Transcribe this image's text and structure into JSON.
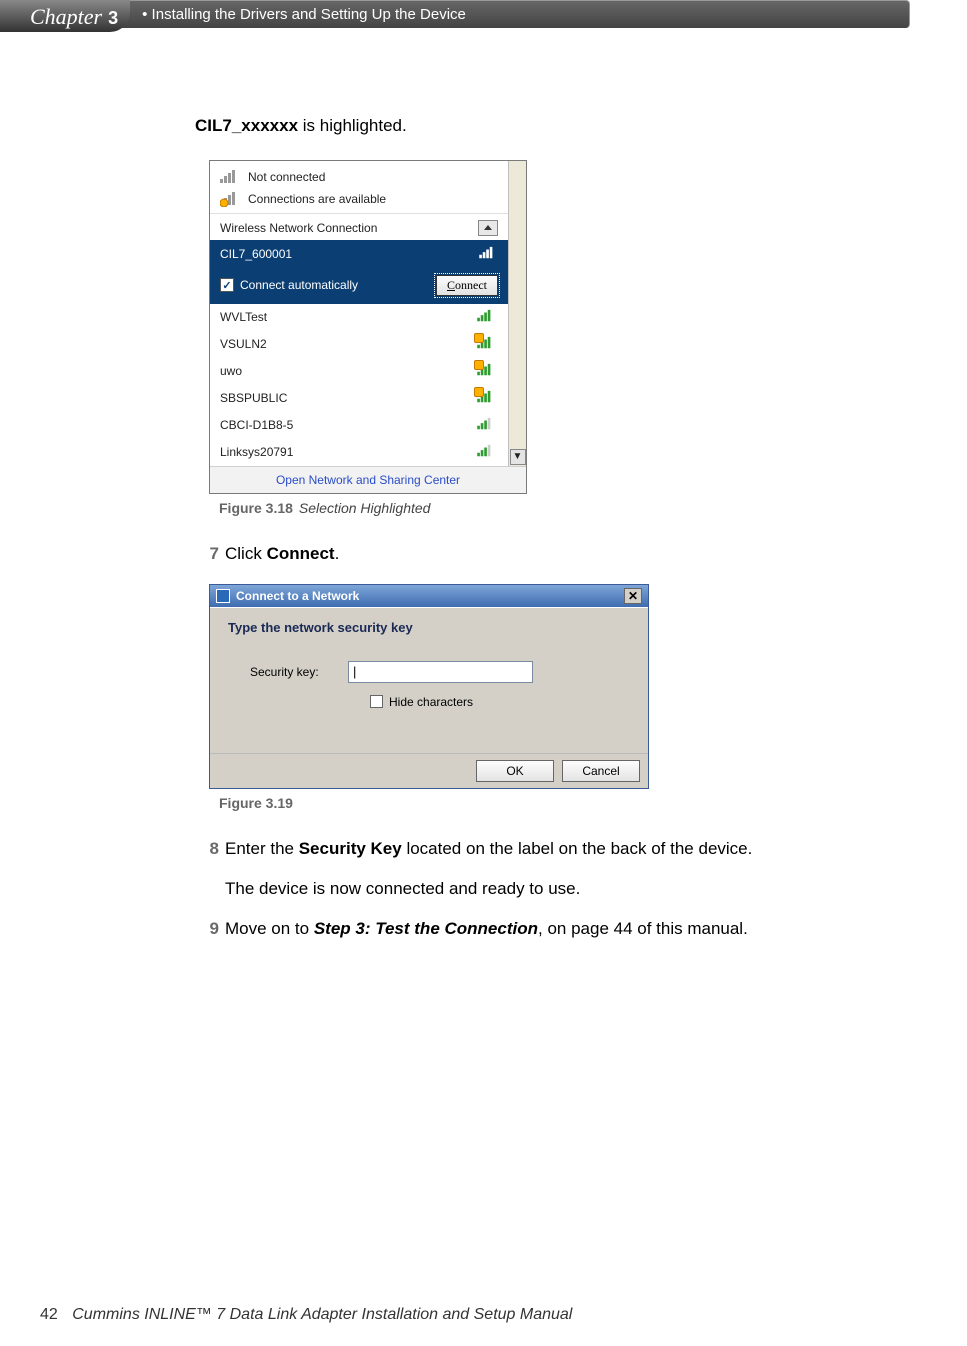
{
  "header": {
    "chapter_word": "Chapter",
    "chapter_number": "3",
    "chapter_title": "• Installing the Drivers and Setting Up the Device"
  },
  "intro_line_prefix_bold": "CIL7_xxxxxx",
  "intro_line_suffix": " is highlighted.",
  "wifi_popup": {
    "not_connected": "Not connected",
    "connections_available": "Connections are available",
    "section_title": "Wireless Network Connection",
    "selected_network": "CIL7_600001",
    "connect_auto_label": "Connect automatically",
    "connect_button_html": "Connect",
    "connect_button_underline": "C",
    "connect_button_rest": "onnect",
    "networks": [
      {
        "name": "WVLTest",
        "secured": false
      },
      {
        "name": "VSULN2",
        "secured": true
      },
      {
        "name": "uwo",
        "secured": true
      },
      {
        "name": "SBSPUBLIC",
        "secured": true
      },
      {
        "name": "CBCI-D1B8-5",
        "secured": false
      },
      {
        "name": "Linksys20791",
        "secured": false
      }
    ],
    "open_center": "Open Network and Sharing Center"
  },
  "figure_318": {
    "label": "Figure 3.18",
    "title": "Selection Highlighted"
  },
  "step7": {
    "num": "7",
    "text_prefix": "Click ",
    "bold": "Connect",
    "suffix": "."
  },
  "dialog": {
    "title": "Connect to a Network",
    "prompt": "Type the network security key",
    "field_label": "Security key:",
    "input_value": "|",
    "hide_label": "Hide characters",
    "ok": "OK",
    "cancel": "Cancel"
  },
  "figure_319": {
    "label": "Figure 3.19",
    "title": ""
  },
  "step8": {
    "num": "8",
    "prefix": "Enter the ",
    "bold": "Security Key",
    "suffix": " located on the label on the back of the device.",
    "extra": "The device is now connected and ready to use."
  },
  "step9": {
    "num": "9",
    "prefix": "Move on to ",
    "bolditalic": "Step 3: Test the Connection",
    "suffix": ", on page 44 of this manual."
  },
  "footer": {
    "page": "42",
    "book": "Cummins INLINE™ 7 Data Link Adapter Installation and Setup Manual"
  }
}
